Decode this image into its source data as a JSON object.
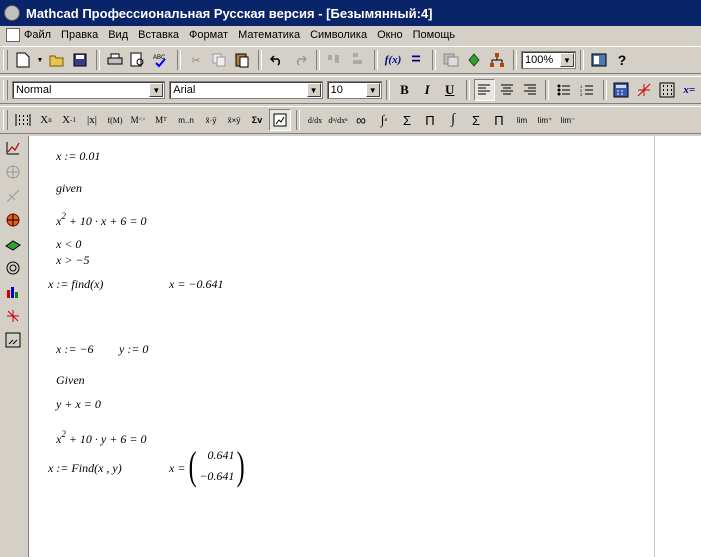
{
  "window": {
    "title": "Mathcad Профессиональная Русская версия - [Безымянный:4]"
  },
  "menu": [
    {
      "label": "Файл"
    },
    {
      "label": "Правка"
    },
    {
      "label": "Вид"
    },
    {
      "label": "Вставка"
    },
    {
      "label": "Формат"
    },
    {
      "label": "Математика"
    },
    {
      "label": "Символика"
    },
    {
      "label": "Окно"
    },
    {
      "label": "Помощь"
    }
  ],
  "toolbar_standard": {
    "zoom": "100%",
    "fx_label": "f(x)"
  },
  "toolbar_format": {
    "style": "Normal",
    "font": "Arial",
    "size": "10",
    "bold": "B",
    "italic": "I",
    "underline": "U",
    "eval_label": "x="
  },
  "toolbar_calculus": {
    "inf": "∞",
    "sum": "Σ",
    "prod": "Π",
    "integral": "∫",
    "lim": "lim"
  },
  "worksheet": {
    "lines": {
      "x_init": "x := 0.01",
      "given1": "given",
      "eq1_a": "x",
      "eq1_b": "2",
      "eq1_c": " + 10 · x + 6 = 0",
      "ineq1": "x < 0",
      "ineq2": "x > −5",
      "find1": "x := find(x)",
      "find1_result": "x = −0.641",
      "xy_init_x": "x := −6",
      "xy_init_y": "y := 0",
      "given2": "Given",
      "eq2": "y + x = 0",
      "eq3_a": "x",
      "eq3_b": "2",
      "eq3_c": " + 10 · y + 6 = 0",
      "find2": "x := Find(x , y)",
      "find2_result_label": "x =",
      "find2_result_1": "0.641",
      "find2_result_2": "−0.641"
    }
  }
}
